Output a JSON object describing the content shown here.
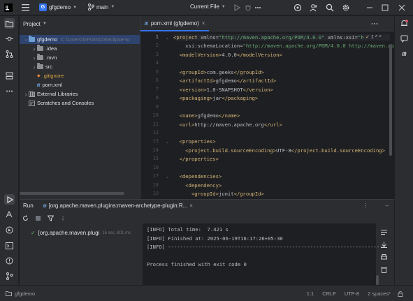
{
  "titlebar": {
    "project_badge": "G",
    "project_name": "gfgdemo",
    "branch": "main",
    "run_config": "Current File"
  },
  "project_pane": {
    "title": "Project",
    "tree": [
      {
        "label": "gfgdemo",
        "path": "C:\\Users\\GFG0323\\eclipse-w",
        "depth": 0,
        "expanded": true,
        "kind": "folder-blue",
        "selected": true
      },
      {
        "label": ".idea",
        "depth": 1,
        "expanded": false,
        "kind": "folder"
      },
      {
        "label": ".mvn",
        "depth": 1,
        "expanded": false,
        "kind": "folder"
      },
      {
        "label": "src",
        "depth": 1,
        "expanded": false,
        "kind": "folder"
      },
      {
        "label": ".gitignore",
        "depth": 1,
        "kind": "file-git"
      },
      {
        "label": "pom.xml",
        "depth": 1,
        "kind": "file-maven"
      },
      {
        "label": "External Libraries",
        "depth": 0,
        "expanded": false,
        "kind": "libs"
      },
      {
        "label": "Scratches and Consoles",
        "depth": 0,
        "kind": "scratch"
      }
    ]
  },
  "editor": {
    "tab_label": "pom.xml (gfgdemo)",
    "inspection_count": "1",
    "line_numbers": [
      "1",
      "2",
      "3",
      "4",
      "5",
      "6",
      "7",
      "8",
      "9",
      "10",
      "11",
      "12",
      "13",
      "14",
      "15",
      "16",
      "17",
      "18",
      "19"
    ],
    "lines": [
      [
        {
          "t": "<project ",
          "c": "tag"
        },
        {
          "t": "xmlns=",
          "c": "attr"
        },
        {
          "t": "\"http://maven.apache.org/POM/4.0.0\"",
          "c": "str"
        },
        {
          "t": " xmlns:xsi=",
          "c": "attr"
        },
        {
          "t": "\"h",
          "c": "str"
        }
      ],
      [
        {
          "t": "    xsi:schemaLocation=",
          "c": "attr"
        },
        {
          "t": "\"http://maven.apache.org/POM/4.0.0 http://maven.apa",
          "c": "str"
        }
      ],
      [
        {
          "t": "  <modelVersion>",
          "c": "tag"
        },
        {
          "t": "4.0.0",
          "c": "txt"
        },
        {
          "t": "</modelVersion>",
          "c": "tag"
        }
      ],
      [],
      [
        {
          "t": "  <groupId>",
          "c": "tag"
        },
        {
          "t": "com.geeks",
          "c": "txt"
        },
        {
          "t": "</groupId>",
          "c": "tag"
        }
      ],
      [
        {
          "t": "  <artifactId>",
          "c": "tag"
        },
        {
          "t": "gfgdemo",
          "c": "txt"
        },
        {
          "t": "</artifactId>",
          "c": "tag"
        }
      ],
      [
        {
          "t": "  <version>",
          "c": "tag"
        },
        {
          "t": "1.0-SNAPSHOT",
          "c": "txt"
        },
        {
          "t": "</version>",
          "c": "tag"
        }
      ],
      [
        {
          "t": "  <packaging>",
          "c": "tag"
        },
        {
          "t": "jar",
          "c": "txt"
        },
        {
          "t": "</packaging>",
          "c": "tag"
        }
      ],
      [],
      [
        {
          "t": "  <name>",
          "c": "tag"
        },
        {
          "t": "gfgdemo",
          "c": "txt"
        },
        {
          "t": "</name>",
          "c": "tag"
        }
      ],
      [
        {
          "t": "  <url>",
          "c": "tag"
        },
        {
          "t": "http://maven.apache.org",
          "c": "txt"
        },
        {
          "t": "</url>",
          "c": "tag"
        }
      ],
      [],
      [
        {
          "t": "  <properties>",
          "c": "tag"
        }
      ],
      [
        {
          "t": "    <project.build.sourceEncoding>",
          "c": "tag"
        },
        {
          "t": "UTF-8",
          "c": "txt"
        },
        {
          "t": "</project.build.sourceEncoding>",
          "c": "tag"
        }
      ],
      [
        {
          "t": "  </properties>",
          "c": "tag"
        }
      ],
      [],
      [
        {
          "t": "  <dependencies>",
          "c": "tag"
        }
      ],
      [
        {
          "t": "    <dependency>",
          "c": "tag"
        }
      ],
      [
        {
          "t": "      <groupId>",
          "c": "tag"
        },
        {
          "t": "junit",
          "c": "txt"
        },
        {
          "t": "</groupId>",
          "c": "tag"
        }
      ]
    ]
  },
  "run_pane": {
    "title": "Run",
    "tab_label": "[org.apache.maven.plugins:maven-archetype-plugin:R...",
    "tree_item": "[org.apache.maven.plugi",
    "tree_item_time": "16 sec, 801 ms",
    "console_lines": [
      "[INFO] Total time:  7.421 s",
      "[INFO] Finished at: 2025-06-19T16:17:26+05:30",
      "[INFO] ------------------------------------------------------------------------",
      "",
      "Process finished with exit code 0"
    ]
  },
  "statusbar": {
    "project": "gfgdemo",
    "position": "1:1",
    "line_sep": "CRLF",
    "encoding": "UTF-8",
    "indent": "2 spaces*"
  },
  "colors": {
    "accent": "#3574f0",
    "xml_tag": "#d5b778",
    "xml_string": "#6aab73",
    "success": "#5fb865"
  }
}
